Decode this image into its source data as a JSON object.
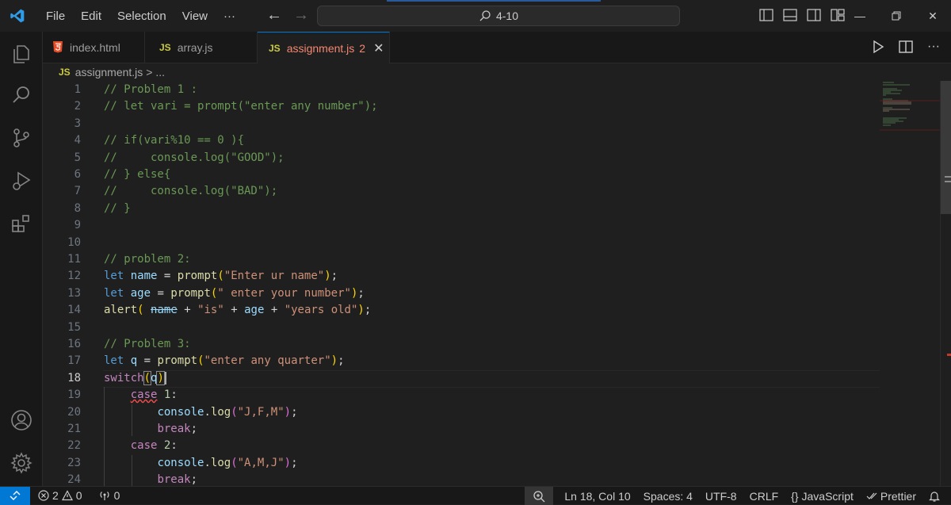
{
  "menu": [
    "File",
    "Edit",
    "Selection",
    "View",
    "···"
  ],
  "command_center": {
    "label": "4-10"
  },
  "tabs": [
    {
      "label": "index.html",
      "icon": "html5-icon",
      "active": false
    },
    {
      "label": "array.js",
      "icon": "JS",
      "active": false
    },
    {
      "label": "assignment.js",
      "icon": "JS",
      "badge": "2",
      "active": true
    }
  ],
  "breadcrumb": {
    "icon": "JS",
    "file": "assignment.js",
    "rest": "> ..."
  },
  "editor": {
    "current_line": 18,
    "line_numbers": [
      "1",
      "2",
      "3",
      "4",
      "5",
      "6",
      "7",
      "8",
      "9",
      "10",
      "11",
      "12",
      "13",
      "14",
      "15",
      "16",
      "17",
      "18",
      "19",
      "20",
      "21",
      "22",
      "23",
      "24"
    ]
  },
  "status": {
    "errors": "2",
    "warnings": "0",
    "ports": "0",
    "position": "Ln 18, Col 10",
    "spaces": "Spaces: 4",
    "encoding": "UTF-8",
    "eol": "CRLF",
    "language": "JavaScript",
    "language_prefix": "{}",
    "formatter": "Prettier"
  },
  "colors": {
    "accent": "#0078d4",
    "js_icon": "#cbcb41",
    "error": "#f14c4c"
  }
}
